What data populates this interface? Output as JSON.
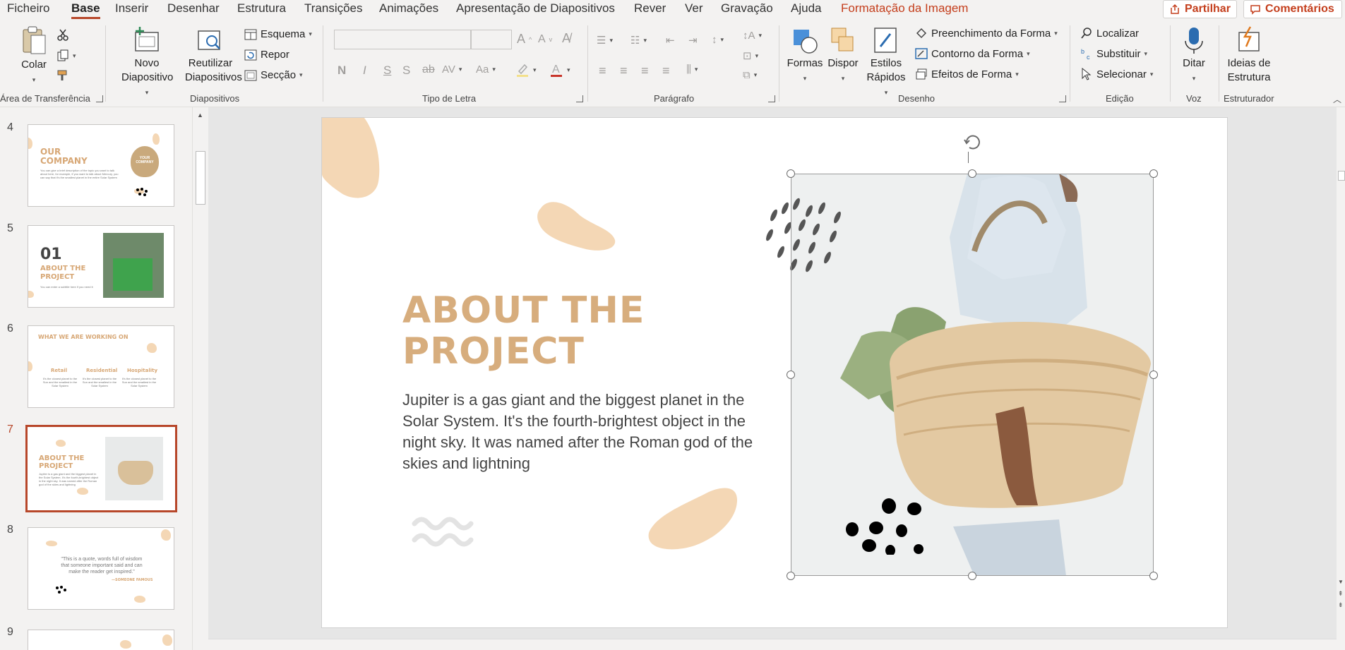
{
  "menu": {
    "tabs": [
      "Ficheiro",
      "Base",
      "Inserir",
      "Desenhar",
      "Estrutura",
      "Transições",
      "Animações",
      "Apresentação de Diapositivos",
      "Rever",
      "Ver",
      "Gravação",
      "Ajuda",
      "Formatação da Imagem"
    ],
    "active": "Base",
    "share": "Partilhar",
    "comments": "Comentários"
  },
  "ribbon": {
    "clipboard": {
      "paste": "Colar",
      "label": "Área de Transferência"
    },
    "slides": {
      "new_slide": "Novo Diapositivo",
      "new_slide_l1": "Novo",
      "new_slide_l2": "Diapositivo",
      "reuse_l1": "Reutilizar",
      "reuse_l2": "Diapositivos",
      "layout": "Esquema",
      "reset": "Repor",
      "section": "Secção",
      "label": "Diapositivos"
    },
    "font": {
      "label": "Tipo de Letra"
    },
    "paragraph": {
      "label": "Parágrafo"
    },
    "drawing": {
      "shapes": "Formas",
      "arrange": "Dispor",
      "quick_styles_l1": "Estilos",
      "quick_styles_l2": "Rápidos",
      "fill": "Preenchimento da Forma",
      "outline": "Contorno da Forma",
      "effects": "Efeitos de Forma",
      "label": "Desenho"
    },
    "editing": {
      "find": "Localizar",
      "replace": "Substituir",
      "select": "Selecionar",
      "label": "Edição"
    },
    "voice": {
      "dictate": "Ditar",
      "label": "Voz"
    },
    "designer": {
      "ideas_l1": "Ideias de",
      "ideas_l2": "Estrutura",
      "label": "Estruturador"
    }
  },
  "thumbnails": {
    "numbers": [
      "4",
      "5",
      "6",
      "7",
      "8",
      "9"
    ],
    "selected": "7",
    "s4": {
      "title_l1": "OUR",
      "title_l2": "COMPANY",
      "badge_l1": "YOUR",
      "badge_l2": "COMPANY",
      "text": "You can give a brief description of the topic you want to talk about here, for example, if you want to talk about Mercury, you can say that it's the smallest planet in the entire Solar System"
    },
    "s5": {
      "num": "01",
      "title_l1": "ABOUT THE",
      "title_l2": "PROJECT",
      "text": "You can enter a subtitle here if you need it"
    },
    "s6": {
      "title": "WHAT WE ARE WORKING ON",
      "cols": [
        "Retail",
        "Residential",
        "Hospitality"
      ],
      "text": "It's the closest planet to the Sun and the smallest in the Solar System"
    },
    "s7": {
      "title_l1": "ABOUT THE",
      "title_l2": "PROJECT",
      "text": "Jupiter is a gas giant and the biggest planet in the Solar System. It's the fourth-brightest object in the night sky. It was named after the Roman god of the skies and lightning"
    },
    "s8": {
      "quote_l1": "\"This is a quote, words full of wisdom",
      "quote_l2": "that someone important said and can",
      "quote_l3": "make the reader get inspired.\"",
      "author": "—SOMEONE FAMOUS"
    }
  },
  "slide": {
    "title_l1": "ABOUT THE",
    "title_l2": "PROJECT",
    "body": "Jupiter is a gas giant and the biggest planet in the Solar System. It's the fourth-brightest object in the night sky. It was named after the Roman god of the skies and lightning"
  },
  "colors": {
    "accent": "#b7472a",
    "title": "#d7ad7d",
    "blob": "#f4d7b5",
    "ribbon_bg": "#f3f2f1"
  }
}
